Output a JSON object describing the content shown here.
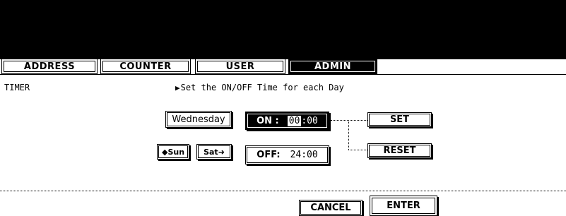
{
  "tabs": [
    {
      "label": "ADDRESS",
      "active": false
    },
    {
      "label": "COUNTER",
      "active": false
    },
    {
      "label": "USER",
      "active": false
    },
    {
      "label": "ADMIN",
      "active": true
    }
  ],
  "screen": {
    "title": "TIMER",
    "message": "Set the ON/OFF Time for each Day"
  },
  "day": {
    "selected": "Wednesday",
    "prev_label": "Sun",
    "next_label": "Sat"
  },
  "on_time": {
    "label": "ON :",
    "hours": "00",
    "separator": ":",
    "minutes": "00"
  },
  "off_time": {
    "label": "OFF:",
    "value": "24:00"
  },
  "actions": {
    "set_label": "SET",
    "reset_label": "RESET",
    "cancel_label": "CANCEL",
    "enter_label": "ENTER"
  },
  "icons": {
    "message_arrow": "right-triangle-icon",
    "prev": "left-arrow-icon",
    "next": "right-arrow-icon"
  }
}
